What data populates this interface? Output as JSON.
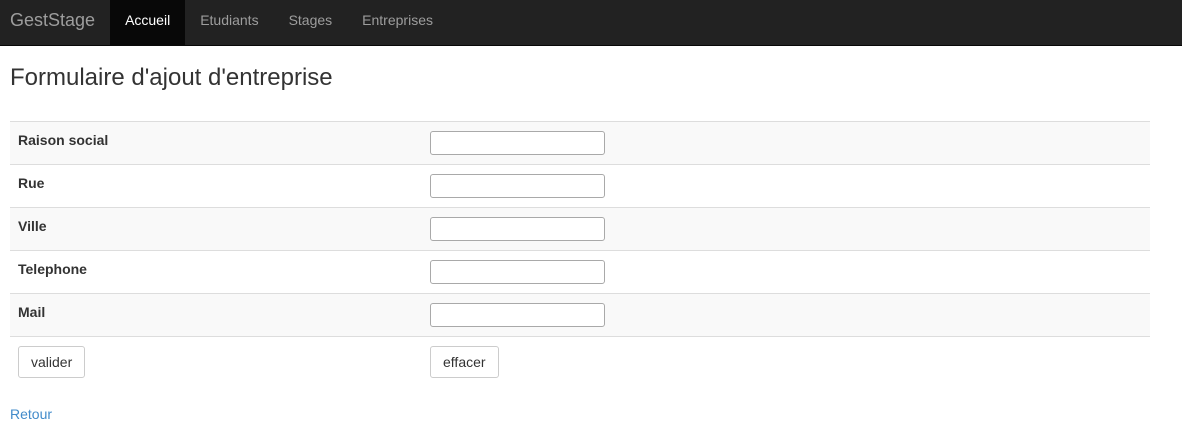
{
  "navbar": {
    "brand": "GestStage",
    "items": [
      {
        "label": "Accueil",
        "active": true
      },
      {
        "label": "Etudiants",
        "active": false
      },
      {
        "label": "Stages",
        "active": false
      },
      {
        "label": "Entreprises",
        "active": false
      }
    ]
  },
  "page": {
    "title": "Formulaire d'ajout d'entreprise"
  },
  "form": {
    "fields": [
      {
        "label": "Raison social",
        "value": ""
      },
      {
        "label": "Rue",
        "value": ""
      },
      {
        "label": "Ville",
        "value": ""
      },
      {
        "label": "Telephone",
        "value": ""
      },
      {
        "label": "Mail",
        "value": ""
      }
    ],
    "submit_label": "valider",
    "reset_label": "effacer"
  },
  "footer": {
    "back_label": "Retour"
  },
  "colors": {
    "navbar_bg": "#222222",
    "active_bg": "#080808",
    "link": "#428bca"
  }
}
